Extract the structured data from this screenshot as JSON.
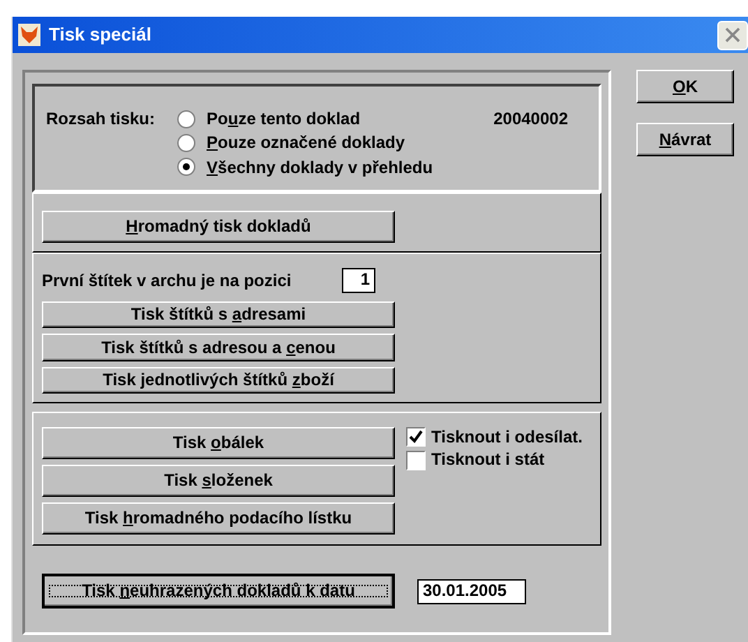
{
  "window": {
    "title": "Tisk speciál"
  },
  "print_range": {
    "label": "Rozsah tisku:",
    "document_number": "20040002",
    "options": [
      {
        "label_start": "Po",
        "accel": "u",
        "label_rest": "ze tento doklad",
        "selected": false
      },
      {
        "accel": "P",
        "label_rest": "ouze označené doklady",
        "selected": false
      },
      {
        "accel": "V",
        "label_rest": "šechny doklady v přehledu",
        "selected": true
      }
    ]
  },
  "bulk_button": {
    "accel": "H",
    "label_rest": "romadný tisk dokladů"
  },
  "labels_section": {
    "position_label": "První štítek v archu je na pozici",
    "position_value": "1",
    "buttons": [
      {
        "label_start": "Tisk štítků s ",
        "accel": "a",
        "label_rest": "dresami"
      },
      {
        "label_start": "Tisk štítků s adresou a ",
        "accel": "c",
        "label_rest": "enou"
      },
      {
        "label_start": "Tisk jednotlivých štítků ",
        "accel": "z",
        "label_rest": "boží"
      }
    ]
  },
  "envelope_section": {
    "buttons": [
      {
        "label_start": "Tisk ",
        "accel": "o",
        "label_rest": "bálek"
      },
      {
        "label_start": "Tisk ",
        "accel": "s",
        "label_rest": "loženek"
      },
      {
        "label_start": "Tisk ",
        "accel": "h",
        "label_rest": "romadného podacího lístku"
      }
    ],
    "checkboxes": [
      {
        "label": "Tisknout i odesílat.",
        "checked": true
      },
      {
        "label": "Tisknout i stát",
        "checked": false
      }
    ]
  },
  "unpaid_button": {
    "label_start": "Tisk ",
    "accel": "n",
    "label_rest": "euhrazených dokladů k datu",
    "focused": true
  },
  "date_field": {
    "value": "30.01.2005"
  },
  "dialog_buttons": [
    {
      "accel": "O",
      "label_rest": "K"
    },
    {
      "accel": "N",
      "label_rest": "ávrat"
    }
  ]
}
